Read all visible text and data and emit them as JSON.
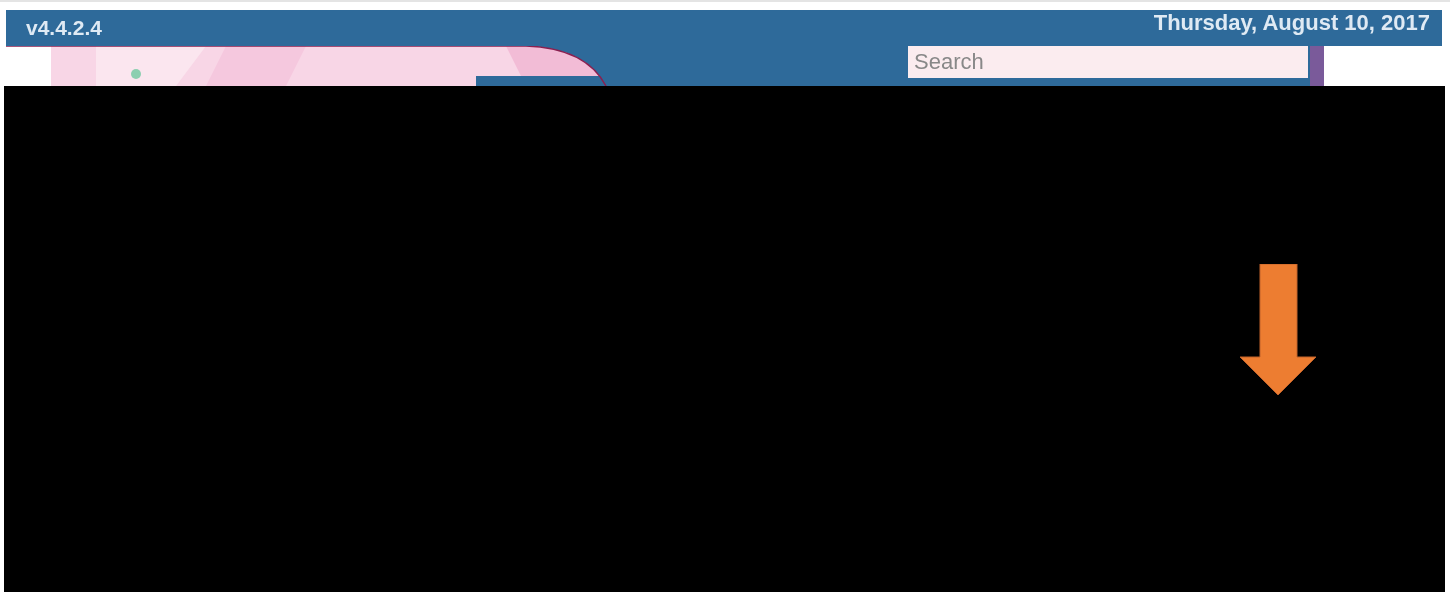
{
  "header": {
    "version": "v4.4.2.4",
    "date": "Thursday, August 10, 2017"
  },
  "search": {
    "placeholder": "Search"
  }
}
